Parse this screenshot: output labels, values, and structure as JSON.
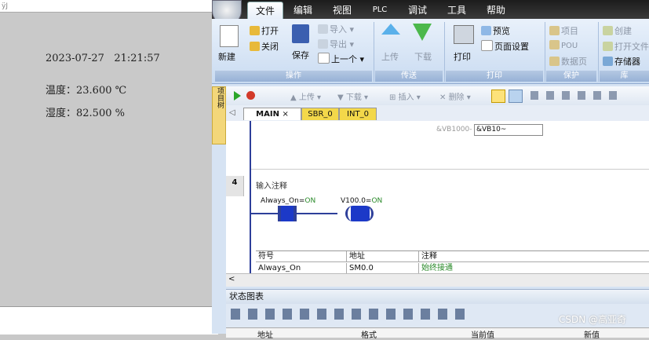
{
  "left_window": {
    "title": "ÿJ",
    "datetime": "2023-07-27   21:21:57",
    "temperature": "温度：23.600 ℃",
    "humidity": "湿度：82.500 %"
  },
  "menu": [
    "文件",
    "编辑",
    "视图",
    "PLC",
    "调试",
    "工具",
    "帮助"
  ],
  "ribbon": {
    "new_label": "新建",
    "open_label": "打开",
    "close_label": "关闭",
    "save_label": "保存",
    "import_label": "导入",
    "export_label": "导出",
    "prev_label": "上一个",
    "group_ops": "操作",
    "upload_label": "上传",
    "download_label": "下载",
    "group_transfer": "传送",
    "print_label": "打印",
    "preview_label": "预览",
    "pagesetup_label": "页面设置",
    "group_print": "打印",
    "project_label": "项目",
    "pou_label": "POU",
    "datapage_label": "数据页",
    "group_protect": "保护",
    "create_label": "创建",
    "openfile_label": "打开文件",
    "storage_label": "存储器",
    "group_lib": "库"
  },
  "toolbar2": {
    "upload_label": "上传",
    "download_label": "下载",
    "insert_label": "插入",
    "delete_label": "删除"
  },
  "sidebar": {
    "tab1": "项目树"
  },
  "program_tabs": [
    "MAIN",
    "SBR_0",
    "INT_0"
  ],
  "editor": {
    "vb_hint": "&VB1000-",
    "vb_value": "&VB10~",
    "network_number": "4",
    "network_comment": "输入注释",
    "contact_label": "Always_On",
    "contact_state": "ON",
    "coil_label": "V100.0",
    "coil_state": "ON"
  },
  "symbol_table": {
    "headers": [
      "符号",
      "地址",
      "注释"
    ],
    "rows": [
      [
        "Always_On",
        "SM0.0",
        "始终接通"
      ]
    ]
  },
  "status_chart": {
    "title": "状态图表",
    "columns": [
      "地址",
      "格式",
      "当前值",
      "新值"
    ]
  },
  "watermark": "CSDN @高亚奇",
  "colors": {
    "accent": "#2d3f9a",
    "contact_on": "#2a8a2a",
    "tab_main": "#f3d84a"
  }
}
